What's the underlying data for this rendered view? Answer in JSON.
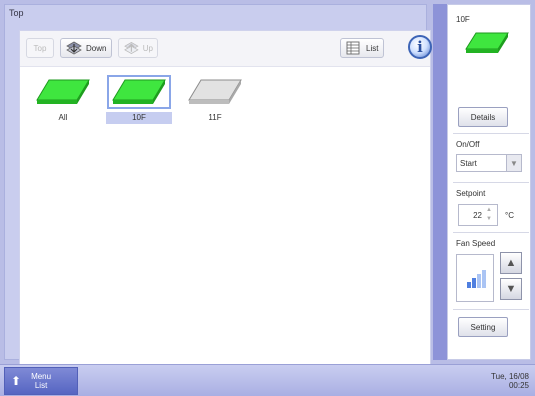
{
  "left_panel": {
    "title": "Top",
    "toolbar": {
      "top_label": "Top",
      "down_label": "Down",
      "up_label": "Up",
      "list_label": "List",
      "info_glyph": "i"
    },
    "floors": [
      {
        "label": "All",
        "color": "#3fe63f",
        "selected": false
      },
      {
        "label": "10F",
        "color": "#3fe63f",
        "selected": true
      },
      {
        "label": "11F",
        "color": "#d9d9d9",
        "selected": false
      }
    ]
  },
  "right_panel": {
    "selected_title": "10F",
    "details_label": "Details",
    "on_off": {
      "label": "On/Off",
      "value": "Start"
    },
    "setpoint": {
      "label": "Setpoint",
      "value": "22",
      "unit": "°C"
    },
    "fan_speed": {
      "label": "Fan Speed"
    },
    "setting_label": "Setting"
  },
  "taskbar": {
    "menu_line1": "Menu",
    "menu_line2": "List",
    "clock_date": "Tue, 16/08",
    "clock_time": "00:25"
  },
  "colors": {
    "floor_active": "#3fe63f",
    "floor_inactive": "#d9d9d9",
    "accent": "#5665c2"
  }
}
